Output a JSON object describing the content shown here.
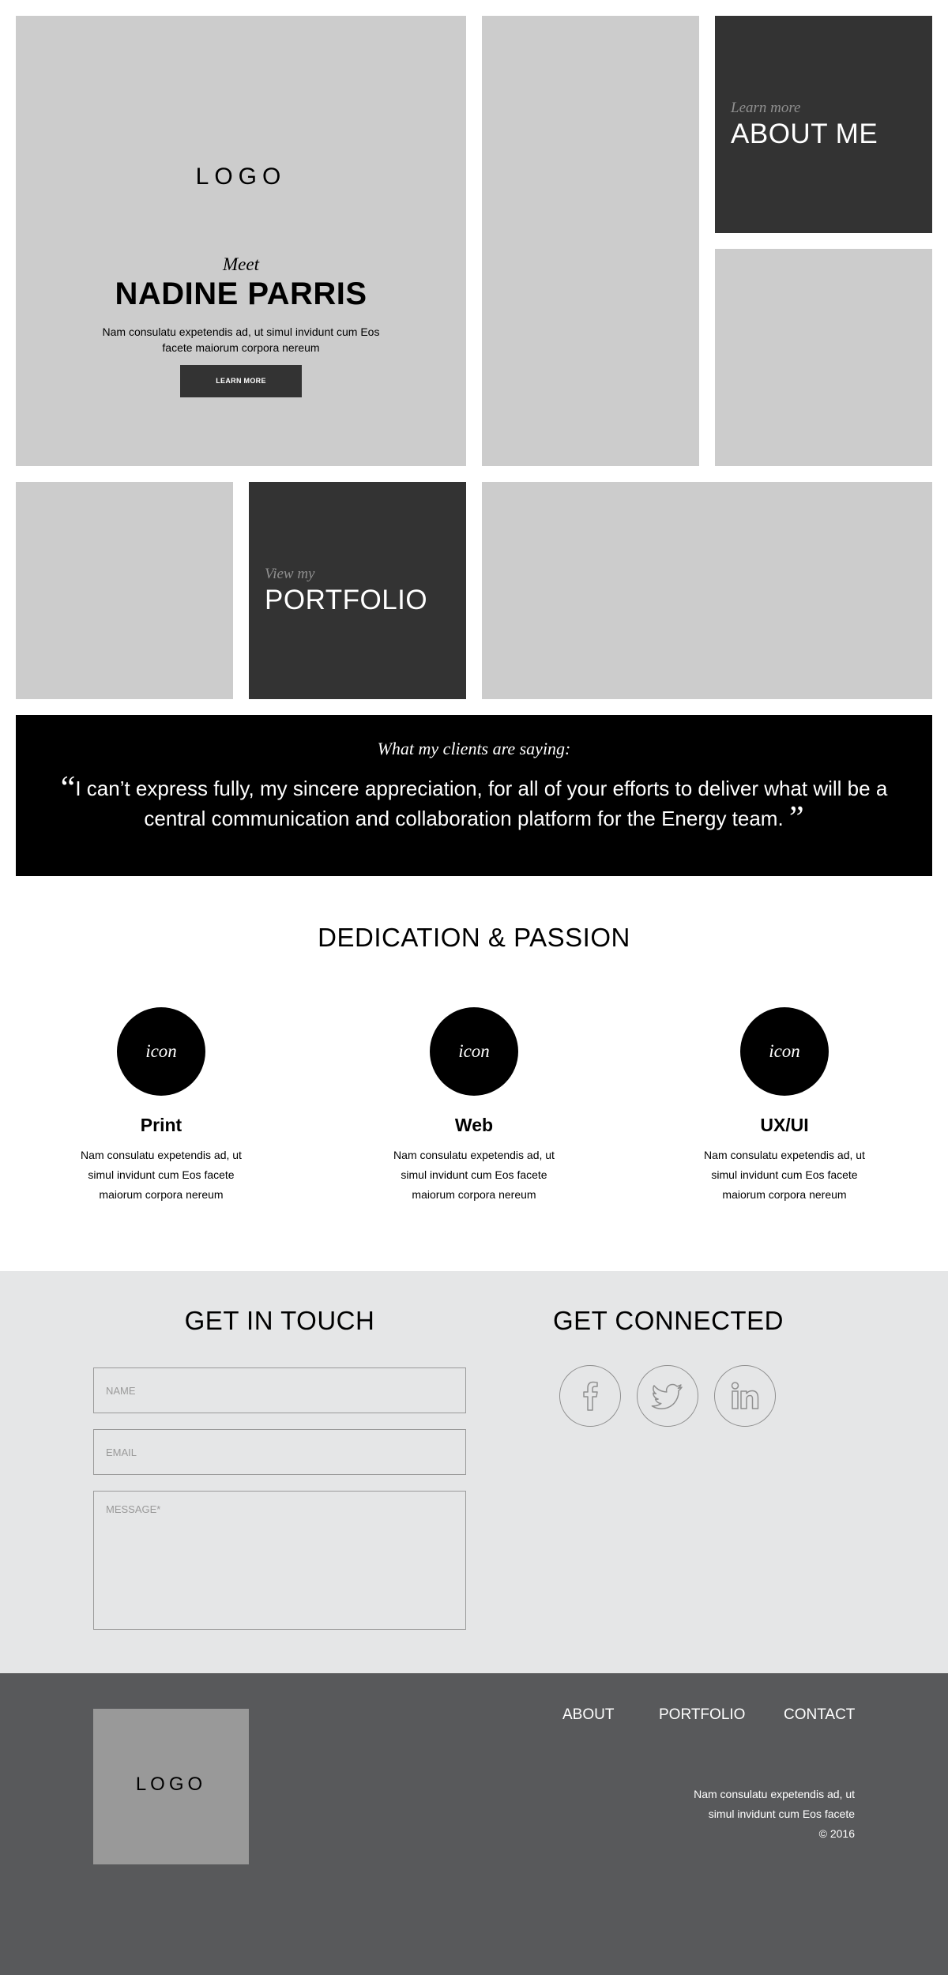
{
  "hero": {
    "logo": "LOGO",
    "meet": "Meet",
    "name": "NADINE PARRIS",
    "description": "Nam consulatu expetendis ad, ut simul invidunt cum Eos facete maiorum corpora nereum",
    "button": "LEARN MORE"
  },
  "about_tile": {
    "small": "Learn more",
    "big": "ABOUT ME"
  },
  "portfolio_tile": {
    "small": "View my",
    "big": "PORTFOLIO"
  },
  "testimonial": {
    "title": "What my clients are saying:",
    "open_quote": "“",
    "quote": "I can’t express fully, my sincere appreciation, for all of your efforts to deliver what will be a central communication and collaboration platform for the Energy team.",
    "close_quote": "”"
  },
  "dedication": {
    "title": "DEDICATION & PASSION",
    "services": [
      {
        "icon": "icon",
        "title": "Print",
        "description": "Nam consulatu expetendis ad, ut simul invidunt cum Eos facete maiorum corpora nereum"
      },
      {
        "icon": "icon",
        "title": "Web",
        "description": "Nam consulatu expetendis ad, ut simul invidunt cum Eos facete maiorum corpora nereum"
      },
      {
        "icon": "icon",
        "title": "UX/UI",
        "description": "Nam consulatu expetendis ad, ut simul invidunt cum Eos facete maiorum corpora nereum"
      }
    ]
  },
  "contact": {
    "title": "GET IN TOUCH",
    "name_placeholder": "NAME",
    "email_placeholder": "EMAIL",
    "message_placeholder": "MESSAGE*"
  },
  "connected": {
    "title": "GET CONNECTED",
    "icons": [
      "facebook-icon",
      "twitter-icon",
      "linkedin-icon"
    ]
  },
  "footer": {
    "logo": "LOGO",
    "nav": [
      "ABOUT",
      "PORTFOLIO",
      "CONTACT"
    ],
    "text_line1": "Nam consulatu expetendis ad, ut",
    "text_line2": "simul invidunt cum Eos facete",
    "copyright": "© 2016"
  },
  "colors": {
    "tile_gray": "#cccccc",
    "dark_tile": "#333333",
    "testimonial_bg": "#000000",
    "contact_bg": "#e5e6e7",
    "footer_bg": "#58595b",
    "footer_logo_bg": "#999999"
  }
}
